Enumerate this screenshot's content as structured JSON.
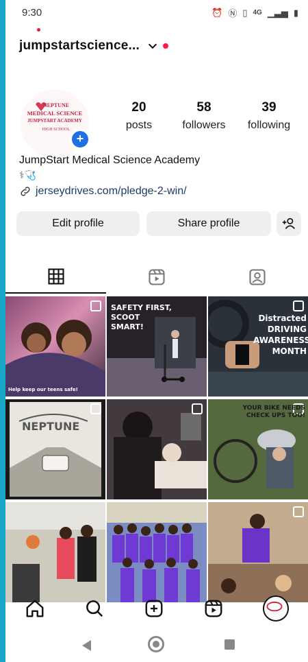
{
  "status": {
    "time": "9:30",
    "network": "4G"
  },
  "profile": {
    "username": "jumpstartscience...",
    "full_name": "JumpStart Medical Science Academy",
    "link": "jerseydrives.com/pledge-2-win/",
    "logo_text": [
      "NEPTUNE",
      "MEDICAL SCIENCE",
      "JUMPSTART ACADEMY",
      "HIGH SCHOOL"
    ]
  },
  "stats": [
    {
      "value": "20",
      "label": "posts"
    },
    {
      "value": "58",
      "label": "followers"
    },
    {
      "value": "39",
      "label": "following"
    }
  ],
  "buttons": {
    "edit": "Edit profile",
    "share": "Share profile"
  },
  "tabs": [
    "grid-tab",
    "reels-tab",
    "tagged-tab"
  ],
  "posts": [
    {
      "caption": "Help keep our teens safe!",
      "theme": "car selfie"
    },
    {
      "caption": "SAFETY FIRST, SCOOT SMART!",
      "theme": "scooter"
    },
    {
      "caption": "Distracted DRIVING AWARENESS MONTH",
      "theme": "phone driving"
    },
    {
      "caption": "NEPTUNE",
      "theme": "drawing"
    },
    {
      "caption": "",
      "theme": "cpr training"
    },
    {
      "caption": "YOUR BIKE NEEDS CHECK UPS TOO!",
      "theme": "bike"
    },
    {
      "caption": "",
      "theme": "classroom"
    },
    {
      "caption": "",
      "theme": "group photo"
    },
    {
      "caption": "",
      "theme": "classroom activity"
    }
  ],
  "colors": {
    "accent": "#1f6fe5",
    "notification": "#ff1d40",
    "link": "#1c3a6b"
  }
}
